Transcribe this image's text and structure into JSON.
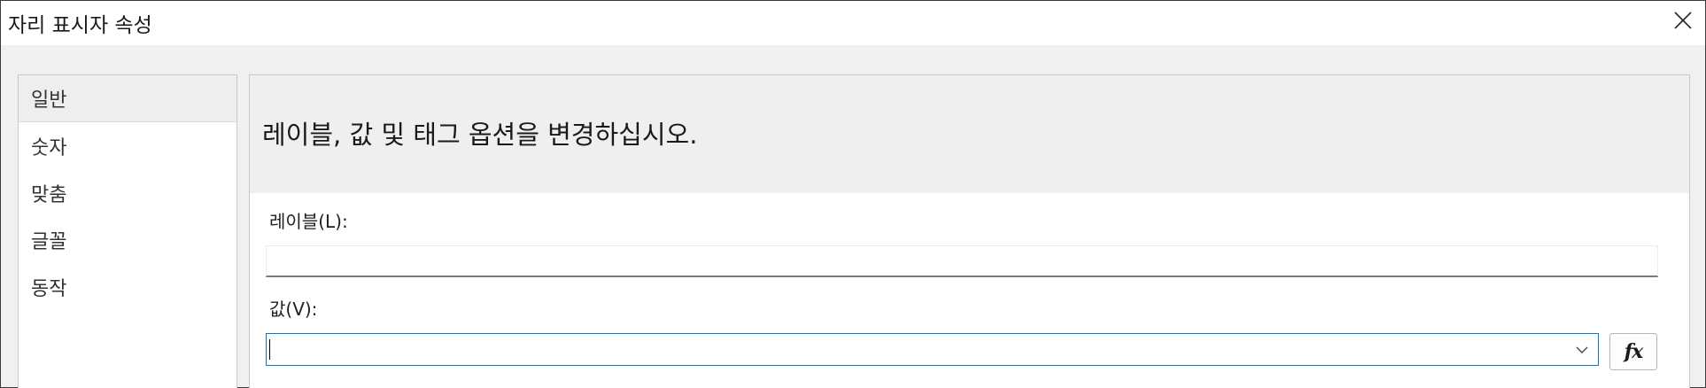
{
  "window": {
    "title": "자리 표시자 속성",
    "close_icon": "close-icon"
  },
  "sidebar": {
    "items": [
      {
        "label": "일반",
        "selected": true
      },
      {
        "label": "숫자",
        "selected": false
      },
      {
        "label": "맞춤",
        "selected": false
      },
      {
        "label": "글꼴",
        "selected": false
      },
      {
        "label": "동작",
        "selected": false
      }
    ]
  },
  "main": {
    "header": "레이블, 값 및 태그 옵션을 변경하십시오.",
    "label_field": {
      "label": "레이블(L):",
      "value": ""
    },
    "value_field": {
      "label": "값(V):",
      "value": "",
      "dropdown_icon": "chevron-down-icon"
    },
    "fx_button": {
      "label": "fx"
    }
  },
  "colors": {
    "focus_border": "#0078d4",
    "header_background": "#efefef",
    "dialog_background": "#f0f0f0"
  }
}
